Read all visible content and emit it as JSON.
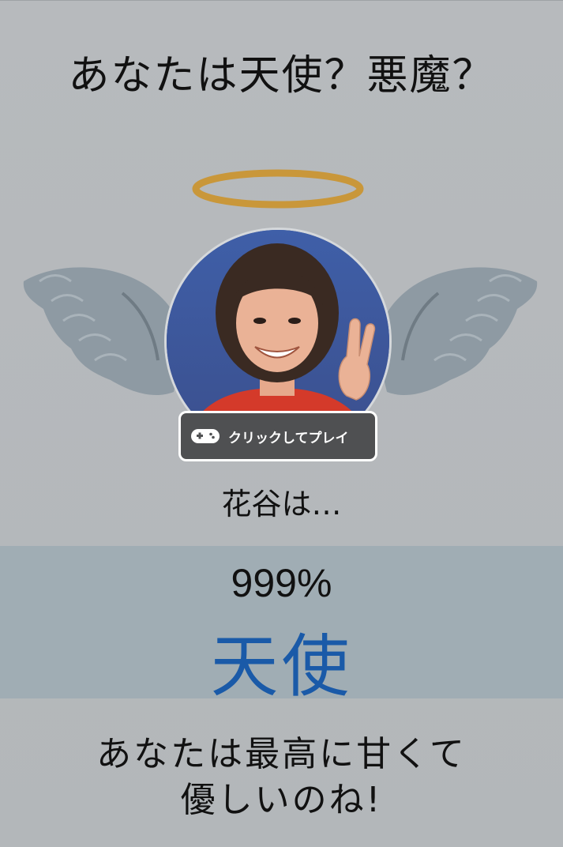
{
  "title": "あなたは天使？悪魔？",
  "play_button": {
    "label": "クリックしてプレイ",
    "icon": "gamepad-icon"
  },
  "name_line": "花谷は…",
  "result": {
    "percent": "999%",
    "verdict": "天使"
  },
  "message": {
    "line1": "あなたは最高に甘くて",
    "line2": "優しいのね!"
  },
  "colors": {
    "background": "#b6b9bb",
    "band": "#a0adb4",
    "verdict": "#1a5aa8",
    "halo": "#c9973a",
    "wing": "#8e9aa3",
    "overlay": "#4f5052"
  }
}
